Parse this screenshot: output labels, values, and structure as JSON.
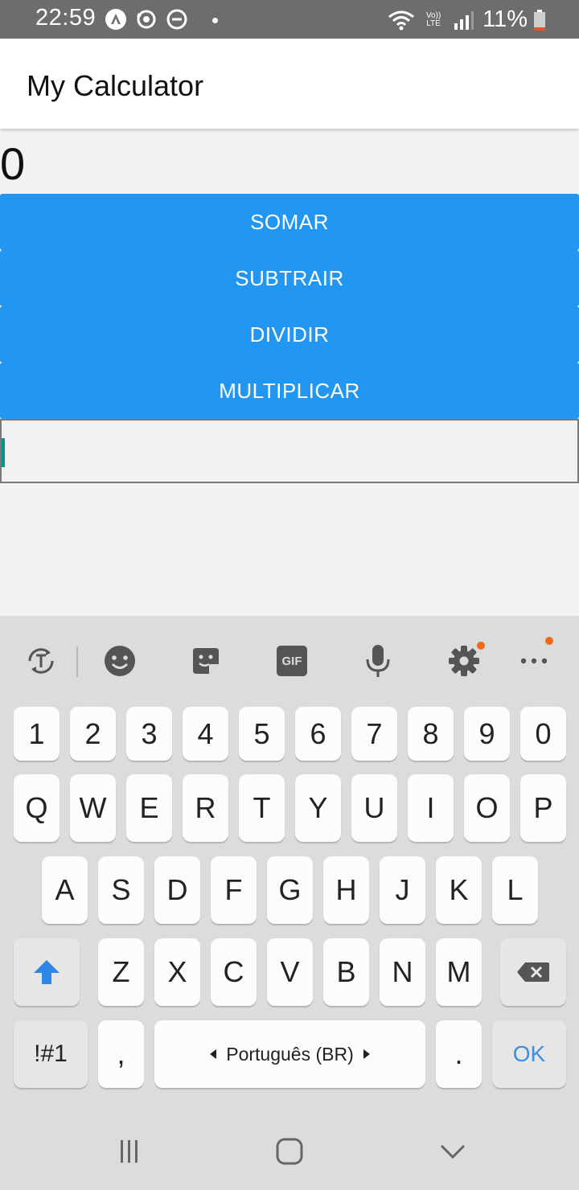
{
  "status_bar": {
    "time": "22:59",
    "battery_text": "11%",
    "icons": [
      "android-auto-icon",
      "sync-icon",
      "do-not-disturb-icon",
      "notification-dot",
      "wifi-icon",
      "volte-lte-icon",
      "signal-icon",
      "battery-icon"
    ],
    "volte_label": "Vo)) LTE"
  },
  "app_bar": {
    "title": "My Calculator"
  },
  "display": {
    "result": "0"
  },
  "operations": [
    {
      "label": "SOMAR"
    },
    {
      "label": "SUBTRAIR"
    },
    {
      "label": "DIVIDIR"
    },
    {
      "label": "MULTIPLICAR"
    }
  ],
  "input": {
    "value": ""
  },
  "keyboard": {
    "toolbar": [
      "translate-icon",
      "emoji-icon",
      "sticker-icon",
      "gif-icon",
      "microphone-icon",
      "settings-icon",
      "more-icon"
    ],
    "gif_label": "GIF",
    "number_row": [
      "1",
      "2",
      "3",
      "4",
      "5",
      "6",
      "7",
      "8",
      "9",
      "0"
    ],
    "row1": [
      "Q",
      "W",
      "E",
      "R",
      "T",
      "Y",
      "U",
      "I",
      "O",
      "P"
    ],
    "row2": [
      "A",
      "S",
      "D",
      "F",
      "G",
      "H",
      "J",
      "K",
      "L"
    ],
    "row3": [
      "Z",
      "X",
      "C",
      "V",
      "B",
      "N",
      "M"
    ],
    "symbols_label": "!#1",
    "comma": ",",
    "space_label": "Português (BR)",
    "period": ".",
    "ok_label": "OK"
  },
  "colors": {
    "status_bar": "#6d6d6d",
    "accent_button": "#2196f3",
    "cursor": "#009688",
    "ok_text": "#3d8ee0",
    "shift_arrow": "#2e86e6",
    "badge": "#f06a1c"
  },
  "nav_bar": [
    "recents-icon",
    "home-icon",
    "back-icon"
  ]
}
